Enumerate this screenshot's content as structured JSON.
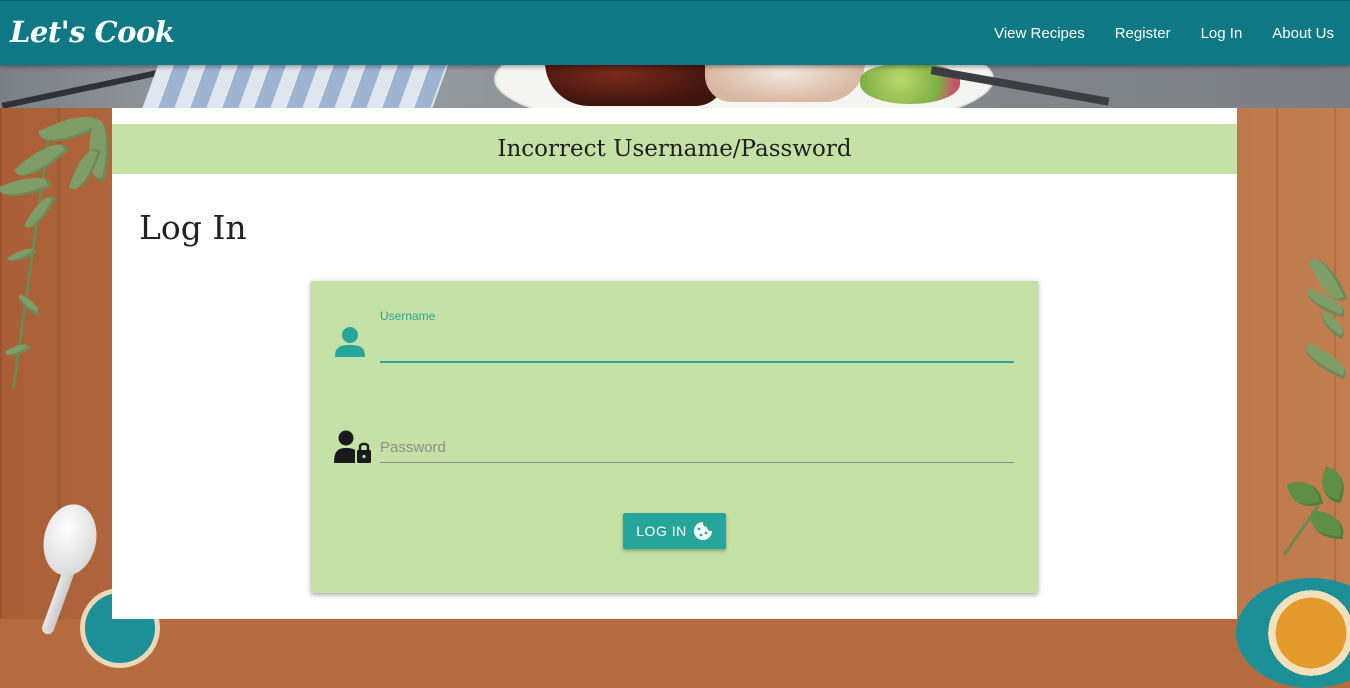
{
  "brand": {
    "logo": "Let's Cook"
  },
  "nav": {
    "items": [
      {
        "label": "View Recipes"
      },
      {
        "label": "Register"
      },
      {
        "label": "Log In"
      },
      {
        "label": "About Us"
      }
    ]
  },
  "flash": {
    "message": "Incorrect Username/Password"
  },
  "page": {
    "title": "Log In"
  },
  "form": {
    "username": {
      "label": "Username",
      "value": "",
      "icon": "user-icon"
    },
    "password": {
      "placeholder": "Password",
      "value": "",
      "icon": "user-lock-icon"
    },
    "submit": {
      "label": "LOG IN",
      "icon": "cookie-icon"
    }
  },
  "colors": {
    "navbar": "#0e7884",
    "flash_bg": "#c5e1a5",
    "form_bg": "#c5e1a5",
    "accent": "#26a69a"
  }
}
